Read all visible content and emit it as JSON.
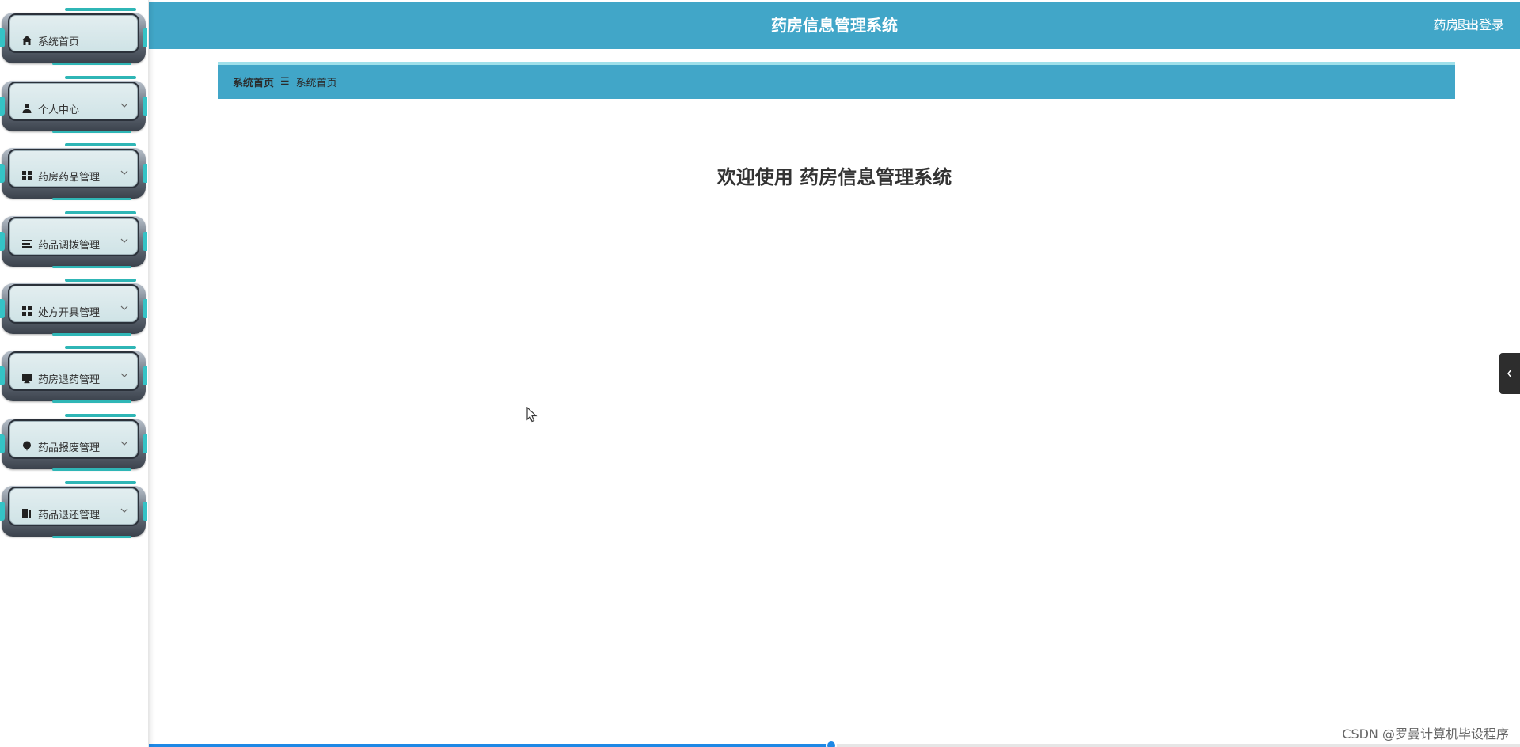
{
  "header": {
    "title": "药房信息管理系统",
    "user": "药房 33",
    "logout_label": "退出登录"
  },
  "sidebar": {
    "items": [
      {
        "label": "系统首页",
        "icon": "home-icon"
      },
      {
        "label": "个人中心",
        "icon": "user-icon"
      },
      {
        "label": "药房药品管理",
        "icon": "grid-icon"
      },
      {
        "label": "药品调拨管理",
        "icon": "menu-lines-icon"
      },
      {
        "label": "处方开具管理",
        "icon": "grid-icon"
      },
      {
        "label": "药房退药管理",
        "icon": "monitor-icon"
      },
      {
        "label": "药品报废管理",
        "icon": "balloon-icon"
      },
      {
        "label": "药品退还管理",
        "icon": "books-icon"
      }
    ]
  },
  "breadcrumb": {
    "root": "系统首页",
    "separator": "☰",
    "current": "系统首页"
  },
  "main": {
    "welcome": "欢迎使用 药房信息管理系统"
  },
  "bottom_bar": {
    "progress_fraction": 0.547
  },
  "watermark": {
    "text": "CSDN @罗曼计算机毕设程序"
  },
  "colors": {
    "header_bg": "#41a6c8",
    "breadcrumb_bg": "#41a6c8",
    "accent": "#2fb6b6",
    "progress": "#1e88e5"
  }
}
